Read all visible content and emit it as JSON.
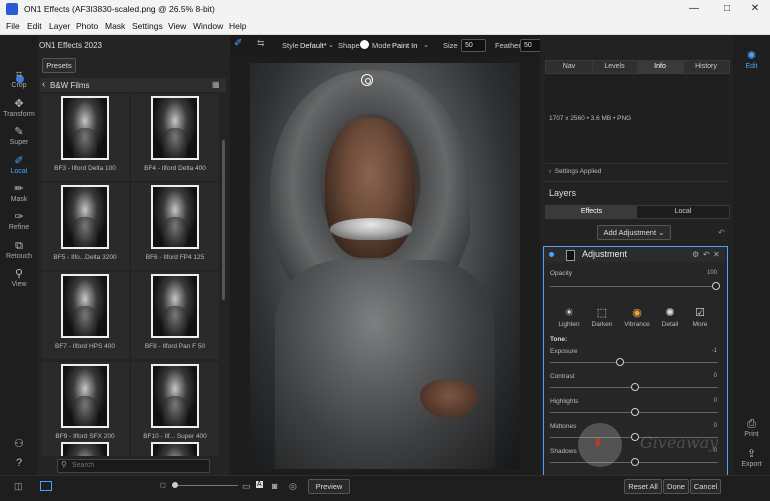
{
  "window": {
    "title": "ON1 Effects (AF3I3830-scaled.png @ 26.5% 8-bit)",
    "minimize": "—",
    "maximize": "□",
    "close": "✕"
  },
  "menu": [
    "File",
    "Edit",
    "Layer",
    "Photo",
    "Mask",
    "Settings",
    "View",
    "Window",
    "Help"
  ],
  "app": {
    "name": "ON1 Effects 2023"
  },
  "left_tools": [
    {
      "label": "Crop",
      "icon": "crop-icon"
    },
    {
      "label": "Transform",
      "icon": "transform-icon"
    },
    {
      "label": "Super",
      "icon": "super-brush-icon"
    },
    {
      "label": "Local",
      "icon": "local-brush-icon"
    },
    {
      "label": "Mask",
      "icon": "mask-icon"
    },
    {
      "label": "Refine",
      "icon": "refine-icon"
    },
    {
      "label": "Retouch",
      "icon": "retouch-icon"
    },
    {
      "label": "View",
      "icon": "view-icon"
    }
  ],
  "browser": {
    "presets_button": "Presets",
    "category": "B&W Films",
    "search_placeholder": "Search",
    "presets": [
      "BF3 - Ilford Delta 100",
      "BF4 - Ilford Delta 400",
      "BF5 - Ilfo...Delta 3200",
      "BF6 - Ilford FP4 125",
      "BF7 - Ilford HPS 400",
      "BF8 - Ilford Pan F 50",
      "BF9 - Ilford SFX 200",
      "BF10 - Ilf... Super 400"
    ]
  },
  "tool_options": {
    "style_label": "Style",
    "style_value": "Default*",
    "shape_label": "Shape",
    "mode_label": "Mode",
    "mode_value": "Paint In",
    "size_label": "Size",
    "size_value": "50",
    "feather_label": "Feather",
    "feather_value": "50"
  },
  "info_panel": {
    "tabs": [
      "Nav",
      "Levels",
      "Info",
      "History"
    ],
    "selected_tab": "Info",
    "image_info": "1707 x 2560 • 3.6 MB • PNG",
    "settings_applied": "Settings Applied"
  },
  "layers": {
    "title": "Layers",
    "tabs": [
      "Effects",
      "Local"
    ],
    "selected_tab": "Effects",
    "add_adjustment": "Add Adjustment"
  },
  "adjustment": {
    "title": "Adjustment",
    "opacity_label": "Opacity",
    "opacity_value": "100",
    "buttons": [
      "Lighten",
      "Darken",
      "Vibrance",
      "Detail",
      "More"
    ],
    "tone_label": "Tone:",
    "sliders": [
      {
        "label": "Exposure",
        "value": "-1",
        "pos": 0.41
      },
      {
        "label": "Contrast",
        "value": "0",
        "pos": 0.5
      },
      {
        "label": "Highlights",
        "value": "0",
        "pos": 0.5
      },
      {
        "label": "Midtones",
        "value": "0",
        "pos": 0.5
      },
      {
        "label": "Shadows",
        "value": "0",
        "pos": 0.5
      }
    ]
  },
  "right_tools": [
    {
      "label": "Edit",
      "icon": "edit-icon"
    },
    {
      "label": "Print",
      "icon": "print-icon"
    },
    {
      "label": "Export",
      "icon": "export-icon"
    }
  ],
  "bottom": {
    "preview": "Preview",
    "reset_all": "Reset All",
    "done": "Done",
    "cancel": "Cancel"
  },
  "watermark": "Giveaway",
  "colors": {
    "accent": "#4aa3ff",
    "panel": "#242424",
    "background": "#1b1b1b"
  }
}
